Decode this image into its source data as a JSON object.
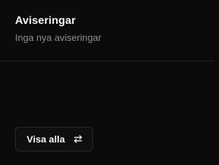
{
  "notifications": {
    "title": "Aviseringar",
    "empty_message": "Inga nya aviseringar",
    "view_all_label": "Visa alla",
    "view_all_icon": "arrows-swap-icon"
  },
  "colors": {
    "background": "#0b0b0c",
    "text_primary": "#f4f4f5",
    "text_secondary": "#8d8d94",
    "border": "#2a2a2e"
  }
}
